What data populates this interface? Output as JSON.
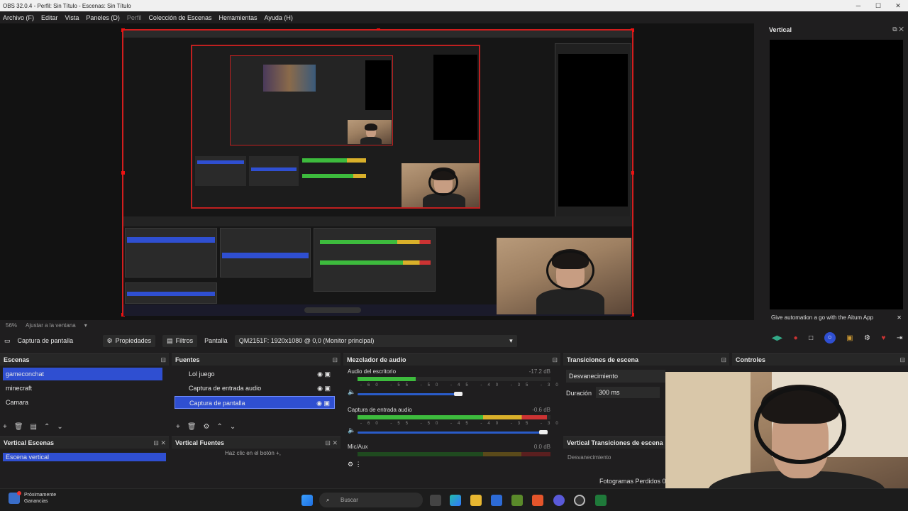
{
  "window": {
    "title": "OBS 32.0.4 - Perfil: Sin Título - Escenas: Sin Título",
    "minimize": "─",
    "maximize": "☐",
    "close": "✕"
  },
  "menu": [
    "Archivo (F)",
    "Editar",
    "Vista",
    "Paneles (D)",
    "Perfil",
    "Colección de Escenas",
    "Herramientas",
    "Ayuda (H)"
  ],
  "zoom": {
    "percent": "56%",
    "fit_label": "Ajustar a la ventana"
  },
  "vertical": {
    "title": "Vertical",
    "toast": "Give automation a go with the Aitum App"
  },
  "source_bar": {
    "source_name": "Captura de pantalla",
    "properties": "Propiedades",
    "filters": "Filtros",
    "screen_label": "Pantalla",
    "screen_value": "QM2151F: 1920x1080 @ 0,0 (Monitor principal)"
  },
  "scenes": {
    "title": "Escenas",
    "items": [
      "gameconchat",
      "minecraft",
      "Camara"
    ],
    "selected": 0
  },
  "sources": {
    "title": "Fuentes",
    "items": [
      "Lol juego",
      "Captura de entrada audio",
      "Captura de pantalla"
    ],
    "selected": 2
  },
  "mixer": {
    "title": "Mezclador de audio",
    "channels": [
      {
        "name": "Audio del escritorio",
        "db": "-17.2 dB",
        "level": 0.3
      },
      {
        "name": "Captura de entrada audio",
        "db": "-0.6 dB",
        "level": 0.98
      },
      {
        "name": "Mic/Aux",
        "db": "0.0 dB",
        "level": 0.0
      }
    ],
    "scale": "-60 -55 -50 -45 -40 -35 -30 -25 -20 -15 -10 -5 0"
  },
  "transitions": {
    "title": "Transiciones de escena",
    "type": "Desvanecimiento",
    "duration_label": "Duración",
    "duration_value": "300 ms"
  },
  "controls": {
    "title": "Controles"
  },
  "vertical_scenes": {
    "title": "Vertical Escenas",
    "item": "Escena vertical"
  },
  "vertical_sources": {
    "title": "Vertical Fuentes",
    "hint": "Haz clic en el botón +,"
  },
  "vertical_transitions": {
    "title": "Vertical Transiciones de escena",
    "type": "Desvanecimiento"
  },
  "status": {
    "dropped_frames": "Fotogramas Perdidos 0"
  },
  "taskbar": {
    "notif_title": "Próximamente",
    "notif_sub": "Ganancias",
    "search_placeholder": "Buscar"
  },
  "colors": {
    "accent": "#2f4fd1",
    "red_border": "#d21d1d",
    "panel_bg": "#1f1e1f"
  }
}
